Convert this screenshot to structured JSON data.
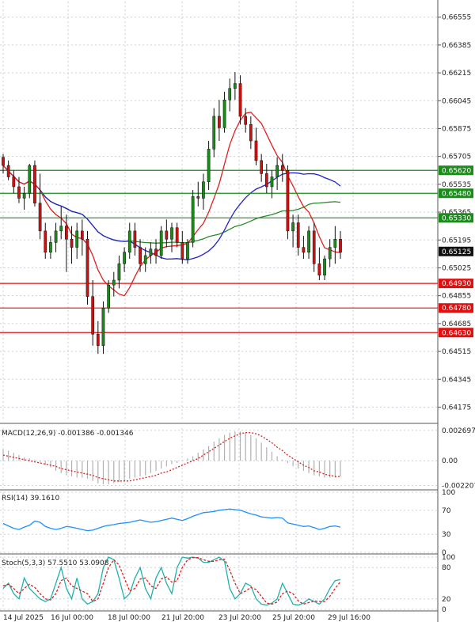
{
  "chart_data": [
    {
      "type": "candlestick",
      "panel": "price",
      "y_ticks": [
        "0.66555",
        "0.66385",
        "0.66215",
        "0.66045",
        "0.65875",
        "0.65705",
        "0.65535",
        "0.65365",
        "0.65195",
        "0.65025",
        "0.64855",
        "0.64685",
        "0.64515",
        "0.64345",
        "0.64175"
      ],
      "ylim": [
        0.641,
        0.6665
      ],
      "current_price": "0.65125",
      "levels": [
        {
          "label": "0.65620",
          "value": 0.6562,
          "color": "#1a8c1a"
        },
        {
          "label": "0.65480",
          "value": 0.6548,
          "color": "#1a8c1a"
        },
        {
          "label": "0.65330",
          "value": 0.6533,
          "color": "#1a8c1a"
        },
        {
          "label": "0.64930",
          "value": 0.6493,
          "color": "#e01010"
        },
        {
          "label": "0.64780",
          "value": 0.6478,
          "color": "#e01010"
        },
        {
          "label": "0.64630",
          "value": 0.6463,
          "color": "#e01010"
        }
      ],
      "candles": [
        [
          0.657,
          0.6572,
          0.656,
          0.6565
        ],
        [
          0.6565,
          0.6568,
          0.6556,
          0.6558
        ],
        [
          0.6558,
          0.6562,
          0.6548,
          0.6552
        ],
        [
          0.6552,
          0.6558,
          0.6542,
          0.6545
        ],
        [
          0.6545,
          0.6552,
          0.6538,
          0.6548
        ],
        [
          0.6548,
          0.6566,
          0.6545,
          0.6565
        ],
        [
          0.6565,
          0.6568,
          0.654,
          0.6542
        ],
        [
          0.6542,
          0.656,
          0.652,
          0.6525
        ],
        [
          0.6525,
          0.653,
          0.6508,
          0.6512
        ],
        [
          0.6512,
          0.6522,
          0.6508,
          0.6518
        ],
        [
          0.6518,
          0.653,
          0.6512,
          0.6525
        ],
        [
          0.6525,
          0.654,
          0.652,
          0.6528
        ],
        [
          0.6528,
          0.6535,
          0.65,
          0.652
        ],
        [
          0.652,
          0.6528,
          0.6505,
          0.6515
        ],
        [
          0.6515,
          0.653,
          0.6508,
          0.6525
        ],
        [
          0.6525,
          0.6532,
          0.651,
          0.652
        ],
        [
          0.652,
          0.6525,
          0.648,
          0.6485
        ],
        [
          0.6485,
          0.6495,
          0.6455,
          0.6462
        ],
        [
          0.6462,
          0.647,
          0.645,
          0.6455
        ],
        [
          0.6455,
          0.6482,
          0.645,
          0.6478
        ],
        [
          0.6478,
          0.6495,
          0.6475,
          0.6492
        ],
        [
          0.6492,
          0.65,
          0.6485,
          0.6495
        ],
        [
          0.6495,
          0.651,
          0.649,
          0.6505
        ],
        [
          0.6505,
          0.6515,
          0.65,
          0.6512
        ],
        [
          0.6512,
          0.653,
          0.6508,
          0.6525
        ],
        [
          0.6525,
          0.653,
          0.651,
          0.6515
        ],
        [
          0.6515,
          0.652,
          0.65,
          0.6505
        ],
        [
          0.6505,
          0.6515,
          0.65,
          0.651
        ],
        [
          0.651,
          0.6518,
          0.6505,
          0.6514
        ],
        [
          0.6514,
          0.652,
          0.6505,
          0.651
        ],
        [
          0.651,
          0.6528,
          0.6508,
          0.6525
        ],
        [
          0.6525,
          0.6532,
          0.6515,
          0.652
        ],
        [
          0.652,
          0.653,
          0.6512,
          0.6527
        ],
        [
          0.6527,
          0.653,
          0.6515,
          0.6518
        ],
        [
          0.6518,
          0.6525,
          0.6505,
          0.6508
        ],
        [
          0.6508,
          0.652,
          0.6505,
          0.6518
        ],
        [
          0.6518,
          0.655,
          0.6515,
          0.6546
        ],
        [
          0.6546,
          0.6555,
          0.654,
          0.6545
        ],
        [
          0.6545,
          0.656,
          0.6538,
          0.6555
        ],
        [
          0.6555,
          0.658,
          0.655,
          0.6575
        ],
        [
          0.6575,
          0.66,
          0.657,
          0.6595
        ],
        [
          0.6595,
          0.6605,
          0.658,
          0.6588
        ],
        [
          0.6588,
          0.661,
          0.6585,
          0.6605
        ],
        [
          0.6605,
          0.6618,
          0.6598,
          0.6612
        ],
        [
          0.6612,
          0.6622,
          0.6605,
          0.6615
        ],
        [
          0.6615,
          0.662,
          0.659,
          0.6595
        ],
        [
          0.6595,
          0.66,
          0.6585,
          0.659
        ],
        [
          0.659,
          0.6595,
          0.6575,
          0.658
        ],
        [
          0.658,
          0.6588,
          0.6565,
          0.6568
        ],
        [
          0.6568,
          0.6572,
          0.6555,
          0.656
        ],
        [
          0.656,
          0.6566,
          0.6548,
          0.6552
        ],
        [
          0.6552,
          0.6562,
          0.6545,
          0.6558
        ],
        [
          0.6558,
          0.657,
          0.655,
          0.6565
        ],
        [
          0.6565,
          0.6572,
          0.6555,
          0.6562
        ],
        [
          0.6562,
          0.6565,
          0.652,
          0.6525
        ],
        [
          0.6525,
          0.6535,
          0.6515,
          0.653
        ],
        [
          0.653,
          0.6535,
          0.651,
          0.6515
        ],
        [
          0.6515,
          0.6522,
          0.6508,
          0.6512
        ],
        [
          0.6512,
          0.6528,
          0.6508,
          0.6525
        ],
        [
          0.6525,
          0.653,
          0.65,
          0.6505
        ],
        [
          0.6505,
          0.6515,
          0.6495,
          0.6498
        ],
        [
          0.6498,
          0.651,
          0.6495,
          0.6508
        ],
        [
          0.6508,
          0.652,
          0.6503,
          0.6515
        ],
        [
          0.6515,
          0.6528,
          0.6505,
          0.652
        ],
        [
          0.652,
          0.6525,
          0.6508,
          0.6512
        ]
      ],
      "x_labels": [
        "14 Jul 2025",
        "16 Jul 00:00",
        "18 Jul 00:00",
        "21 Jul 20:00",
        "23 Jul 20:00",
        "25 Jul 20:00",
        "29 Jul 16:00"
      ]
    },
    {
      "type": "histogram",
      "panel": "macd",
      "label": "MACD(12,26,9) -0.001386 -0.001346",
      "y_ticks": [
        "0.002697",
        "0.00",
        "-0.002207"
      ],
      "ylim": [
        -0.00245,
        0.0029
      ],
      "values": [
        0.001,
        0.0009,
        0.0007,
        0.0005,
        0.0003,
        0.0002,
        0.0001,
        -0.0001,
        -0.0004,
        -0.0006,
        -0.0009,
        -0.0011,
        -0.0013,
        -0.0014,
        -0.0015,
        -0.0015,
        -0.0016,
        -0.0018,
        -0.002,
        -0.0021,
        -0.0021,
        -0.002,
        -0.0019,
        -0.0018,
        -0.0016,
        -0.0015,
        -0.0014,
        -0.0013,
        -0.0011,
        -0.0009,
        -0.0007,
        -0.0005,
        -0.0003,
        -0.0002,
        0.0,
        0.0002,
        0.0004,
        0.0007,
        0.001,
        0.0013,
        0.0017,
        0.002,
        0.0023,
        0.0025,
        0.0026,
        0.0026,
        0.0025,
        0.0023,
        0.002,
        0.0016,
        0.0012,
        0.0008,
        0.0004,
        0.0001,
        -0.0002,
        -0.0005,
        -0.0007,
        -0.0009,
        -0.0011,
        -0.0013,
        -0.0014,
        -0.0015,
        -0.0015,
        -0.0015,
        -0.0014
      ],
      "signal": [
        0.0005,
        0.0004,
        0.0003,
        0.0002,
        0.0001,
        0.0,
        -0.0001,
        -0.0002,
        -0.0003,
        -0.0004,
        -0.0005,
        -0.0007,
        -0.0008,
        -0.0009,
        -0.001,
        -0.0011,
        -0.0012,
        -0.0013,
        -0.0015,
        -0.0016,
        -0.0017,
        -0.0018,
        -0.0018,
        -0.0018,
        -0.0018,
        -0.0017,
        -0.0016,
        -0.0015,
        -0.0014,
        -0.0013,
        -0.0011,
        -0.001,
        -0.0008,
        -0.0006,
        -0.0004,
        -0.0002,
        0.0,
        0.0002,
        0.0005,
        0.0008,
        0.0011,
        0.0014,
        0.0017,
        0.002,
        0.0022,
        0.0024,
        0.0025,
        0.0025,
        0.0024,
        0.0022,
        0.0019,
        0.0016,
        0.0012,
        0.0009,
        0.0005,
        0.0002,
        -0.0001,
        -0.0004,
        -0.0006,
        -0.0009,
        -0.001,
        -0.0012,
        -0.0013,
        -0.0014,
        -0.0014
      ]
    },
    {
      "type": "line",
      "panel": "rsi",
      "label": "RSI(14) 39.1610",
      "y_ticks": [
        "100",
        "70",
        "30",
        "0"
      ],
      "ylim": [
        0,
        100
      ],
      "values": [
        48,
        44,
        40,
        38,
        42,
        45,
        52,
        50,
        43,
        40,
        38,
        40,
        43,
        42,
        40,
        38,
        36,
        37,
        40,
        43,
        45,
        46,
        48,
        49,
        50,
        52,
        54,
        52,
        50,
        51,
        53,
        55,
        57,
        55,
        53,
        56,
        60,
        63,
        66,
        67,
        68,
        70,
        71,
        72,
        71,
        70,
        67,
        64,
        62,
        59,
        58,
        57,
        58,
        57,
        49,
        47,
        45,
        43,
        44,
        41,
        38,
        40,
        43,
        44,
        42
      ]
    },
    {
      "type": "line",
      "panel": "stoch",
      "label": "Stoch(5,3,3) 57.5510 53.0908",
      "y_ticks": [
        "100",
        "80",
        "20",
        "0"
      ],
      "ylim": [
        0,
        100
      ],
      "k": [
        40,
        50,
        30,
        20,
        60,
        40,
        30,
        20,
        15,
        20,
        50,
        80,
        40,
        20,
        60,
        20,
        10,
        15,
        30,
        80,
        100,
        95,
        60,
        20,
        30,
        60,
        80,
        40,
        20,
        60,
        80,
        50,
        30,
        80,
        100,
        98,
        100,
        98,
        90,
        90,
        95,
        100,
        92,
        40,
        20,
        30,
        50,
        45,
        20,
        10,
        8,
        12,
        20,
        50,
        30,
        10,
        8,
        12,
        20,
        15,
        10,
        20,
        40,
        55,
        57
      ],
      "d": [
        45,
        48,
        40,
        30,
        40,
        48,
        42,
        30,
        20,
        18,
        30,
        55,
        60,
        45,
        40,
        35,
        30,
        15,
        20,
        50,
        80,
        95,
        85,
        60,
        35,
        40,
        58,
        60,
        45,
        40,
        58,
        62,
        52,
        55,
        80,
        95,
        99,
        99,
        95,
        92,
        92,
        95,
        96,
        75,
        50,
        30,
        35,
        42,
        38,
        25,
        12,
        10,
        14,
        30,
        35,
        30,
        16,
        10,
        13,
        16,
        15,
        15,
        25,
        40,
        53
      ]
    }
  ]
}
